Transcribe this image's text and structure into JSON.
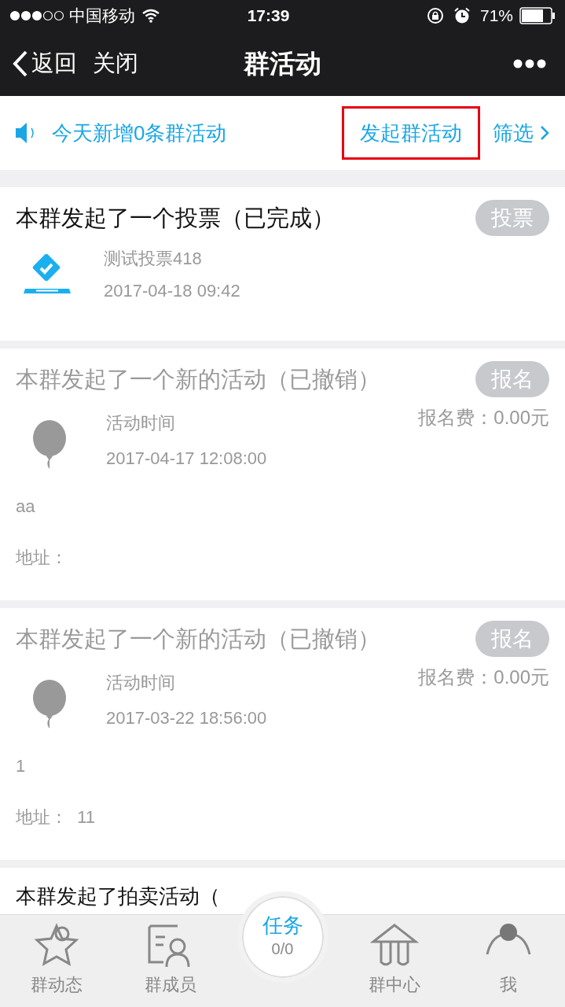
{
  "status_bar": {
    "carrier": "中国移动",
    "time": "17:39",
    "battery": "71%"
  },
  "nav": {
    "back": "返回",
    "close": "关闭",
    "title": "群活动"
  },
  "notice": {
    "text": "今天新增0条群活动",
    "create": "发起群活动",
    "filter": "筛选"
  },
  "cards": [
    {
      "kind": "vote",
      "title": "本群发起了一个投票（已完成）",
      "cancelled": false,
      "badge": "投票",
      "line1": "测试投票418",
      "line2": "2017-04-18 09:42"
    },
    {
      "kind": "activity",
      "title": "本群发起了一个新的活动（已撤销）",
      "cancelled": true,
      "badge": "报名",
      "line1": "活动时间",
      "line2": "2017-04-17 12:08:00",
      "fee": "报名费：0.00元",
      "note": "aa",
      "address": "地址："
    },
    {
      "kind": "activity",
      "title": "本群发起了一个新的活动（已撤销）",
      "cancelled": true,
      "badge": "报名",
      "line1": "活动时间",
      "line2": "2017-03-22 18:56:00",
      "fee": "报名费：0.00元",
      "note": "1",
      "address": "地址：  11"
    },
    {
      "kind": "auction",
      "title": "本群发起了拍卖活动（",
      "cancelled": false
    }
  ],
  "tabs": [
    {
      "label": "群动态"
    },
    {
      "label": "群成员"
    },
    {
      "label": "任务",
      "count": "0/0"
    },
    {
      "label": "群中心"
    },
    {
      "label": "我"
    }
  ]
}
